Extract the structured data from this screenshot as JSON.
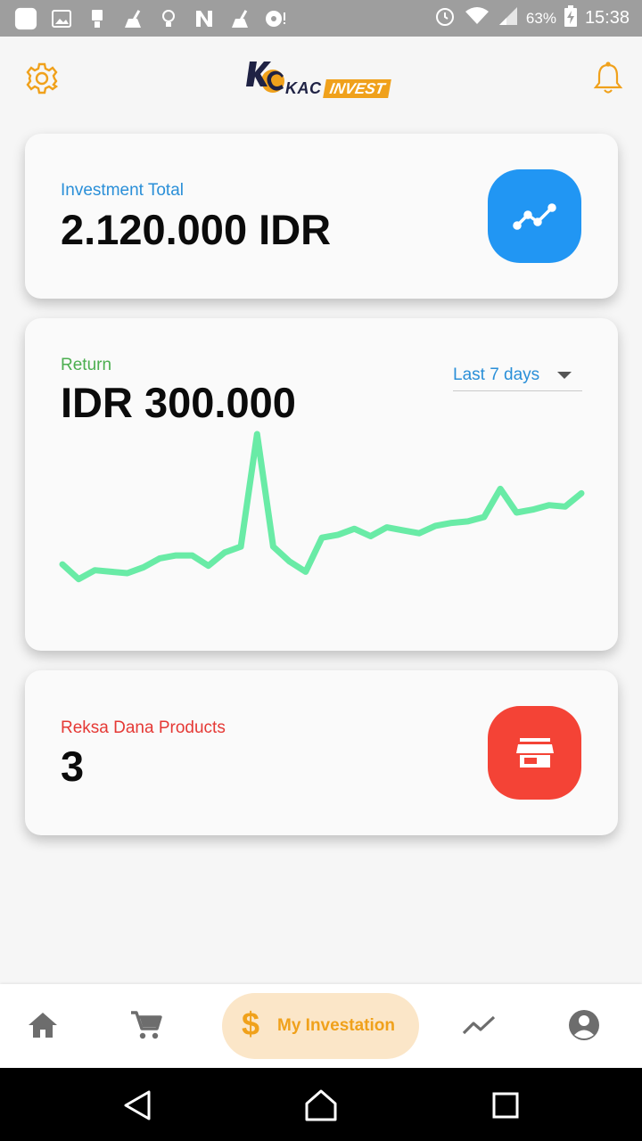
{
  "status_bar": {
    "battery": "63%",
    "time": "15:38",
    "left_icons": [
      "gallery-icon",
      "image-icon",
      "sim-icon",
      "cleaner-icon",
      "bulb-icon",
      "n-icon",
      "cleaner-icon",
      "disc-icon"
    ],
    "right_icons": [
      "alarm-icon",
      "wifi-icon",
      "signal-icon",
      "battery-charging-icon"
    ]
  },
  "header": {
    "logo_kac": "KAC",
    "logo_invest": "INVEST",
    "settings_icon": "gear-icon",
    "notifications_icon": "bell-icon"
  },
  "investment_total": {
    "label": "Investment Total",
    "value": "2.120.000 IDR",
    "icon": "trending-line-icon"
  },
  "return": {
    "label": "Return",
    "value": "IDR 300.000",
    "range_selected": "Last 7 days"
  },
  "products": {
    "label": "Reksa Dana Products",
    "value": "3",
    "icon": "store-icon"
  },
  "bottom_nav": {
    "items": [
      "home-icon",
      "cart-icon",
      "dollar-icon",
      "trending-icon",
      "account-icon"
    ],
    "active_label": "My Investation",
    "active_symbol": "$"
  },
  "colors": {
    "accent_orange": "#f0a11b",
    "blue": "#2196f3",
    "red": "#f44336",
    "green_label": "#4caf50",
    "chart_line": "#69eba6",
    "blue_label": "#2a8fd8",
    "red_label": "#e53935"
  },
  "chart_data": {
    "type": "line",
    "title": "",
    "xlabel": "",
    "ylabel": "",
    "series": [
      {
        "values": [
          12,
          2,
          8,
          7,
          6,
          10,
          16,
          18,
          18,
          11,
          20,
          24,
          100,
          24,
          14,
          7,
          30,
          32,
          36,
          31,
          37,
          35,
          33,
          38,
          40,
          41,
          44,
          63,
          47,
          49,
          52,
          51,
          60
        ]
      }
    ]
  }
}
